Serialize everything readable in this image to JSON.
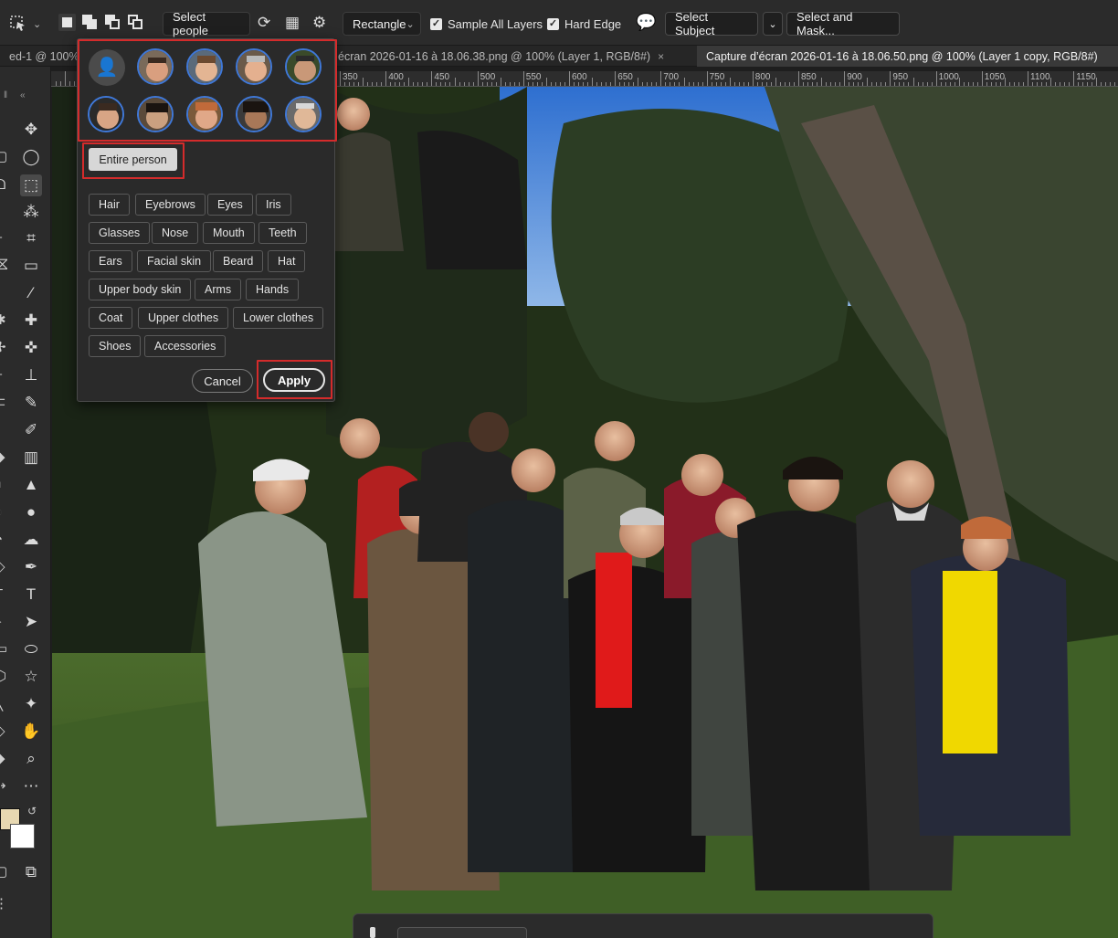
{
  "options_bar": {
    "select_people": "Select people",
    "mode_dropdown": "Rectangle",
    "sample_all_layers": {
      "label": "Sample All Layers",
      "checked": true
    },
    "hard_edge": {
      "label": "Hard Edge",
      "checked": true
    },
    "select_subject": "Select Subject",
    "select_and_mask": "Select and Mask..."
  },
  "tabs": [
    {
      "label": "ed-1 @ 100%",
      "close": "×",
      "active": false
    },
    {
      "label": "écran 2026-01-16 à 18.06.38.png @ 100% (Layer 1, RGB/8#)",
      "close": "×",
      "active": false
    },
    {
      "label": "Capture d’écran 2026-01-16 à 18.06.50.png @ 100% (Layer 1 copy, RGB/8#)",
      "close": "",
      "active": true
    }
  ],
  "ruler": {
    "labels": [
      "350",
      "400",
      "450",
      "500",
      "550",
      "600",
      "650",
      "700",
      "750",
      "800",
      "850",
      "900",
      "950",
      "1000",
      "1050",
      "1100",
      "1150"
    ]
  },
  "popup": {
    "entire_person": "Entire person",
    "parts": [
      [
        "Hair",
        "Eyebrows",
        "Eyes",
        "Iris"
      ],
      [
        "Glasses",
        "Nose",
        "Mouth",
        "Teeth"
      ],
      [
        "Ears",
        "Facial skin",
        "Beard",
        "Hat"
      ],
      [
        "Upper body skin",
        "Arms",
        "Hands"
      ],
      [
        "Coat",
        "Upper clothes",
        "Lower clothes"
      ],
      [
        "Shoes",
        "Accessories"
      ]
    ],
    "cancel": "Cancel",
    "apply": "Apply"
  },
  "colors": {
    "foreground": "#e7d8b1",
    "background": "#ffffff",
    "face_ring": "#3f78d8",
    "highlight": "#d42b2b"
  },
  "icons": {
    "all_people": "person-icon",
    "tool_preset": "object-selection-icon"
  }
}
